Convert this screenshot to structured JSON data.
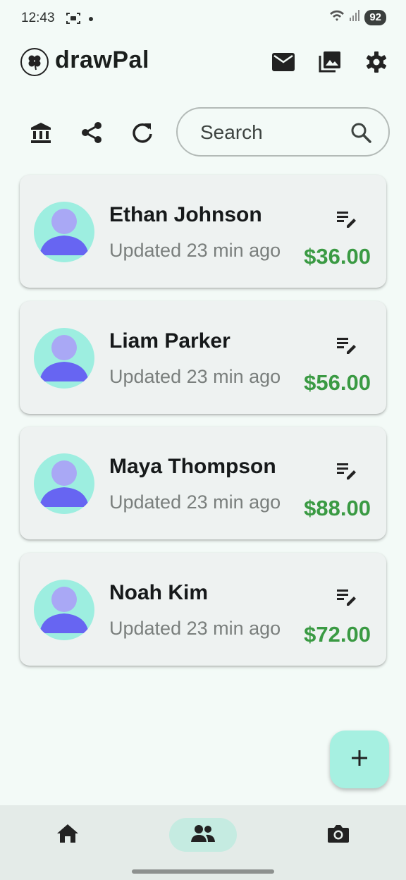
{
  "status": {
    "time": "12:43",
    "battery": "92"
  },
  "app": {
    "title": "drawPal"
  },
  "search": {
    "placeholder": "Search"
  },
  "contacts": [
    {
      "name": "Ethan Johnson",
      "updated": "Updated 23 min ago",
      "amount": "$36.00"
    },
    {
      "name": "Liam Parker",
      "updated": "Updated 23 min ago",
      "amount": "$56.00"
    },
    {
      "name": "Maya Thompson",
      "updated": "Updated 23 min ago",
      "amount": "$88.00"
    },
    {
      "name": "Noah Kim",
      "updated": "Updated 23 min ago",
      "amount": "$72.00"
    }
  ],
  "icons": {
    "appbar": [
      "mail-icon",
      "gallery-icon",
      "settings-icon"
    ],
    "toolbar": [
      "bank-icon",
      "share-icon",
      "refresh-icon"
    ],
    "bottom_nav": [
      "home-icon",
      "people-icon",
      "camera-icon"
    ]
  },
  "colors": {
    "accent": "#a6f0e1",
    "amount": "#3a9a43",
    "background": "#f3faf7",
    "card": "#eef2f1"
  },
  "bottom_nav": {
    "active": "people"
  }
}
